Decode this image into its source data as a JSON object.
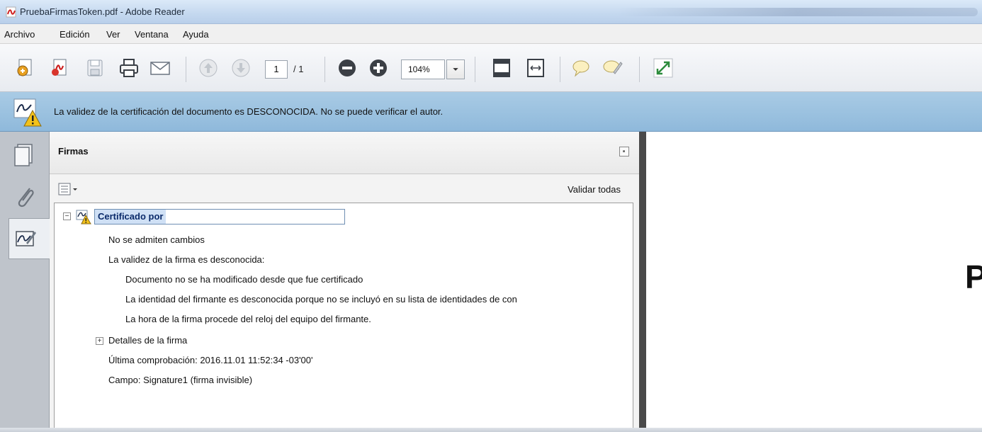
{
  "window": {
    "title": "PruebaFirmasToken.pdf - Adobe Reader",
    "app_icon": "pdf-document-icon"
  },
  "menubar": {
    "items": [
      "Archivo",
      "Edición",
      "Ver",
      "Ventana",
      "Ayuda"
    ]
  },
  "toolbar": {
    "current_page": "1",
    "page_count": "/ 1",
    "zoom": "104%",
    "icons": [
      "create-pdf-icon",
      "open-pdf-icon",
      "save-icon",
      "print-icon",
      "email-icon",
      "previous-page-icon",
      "next-page-icon",
      "zoom-out-icon",
      "zoom-in-icon",
      "dropdown-arrow-icon",
      "fit-page-icon",
      "fit-width-icon",
      "comment-icon",
      "highlight-icon",
      "full-screen-icon"
    ]
  },
  "infobar": {
    "message": "La validez de la certificación del documento es DESCONOCIDA. No se puede verificar el autor.",
    "background": "#9cc2e0"
  },
  "signatures_panel": {
    "title": "Firmas",
    "validate_all": "Validar todas",
    "certificate_label": "Certificado por",
    "no_changes": "No se admiten cambios",
    "validity_unknown": "La validez de la firma es desconocida:",
    "doc_not_modified": "Documento no se ha modificado desde que fue certificado",
    "identity_unknown": "La identidad del firmante es desconocida porque no se incluyó en su lista de identidades de con",
    "time_source": "La hora de la firma procede del reloj del equipo del firmante.",
    "details": "Detalles de la firma",
    "last_checked": "Última comprobación: 2016.11.01 11:52:34 -03'00'",
    "field": "Campo: Signature1 (firma invisible)"
  },
  "document": {
    "visible_letter": "P"
  }
}
